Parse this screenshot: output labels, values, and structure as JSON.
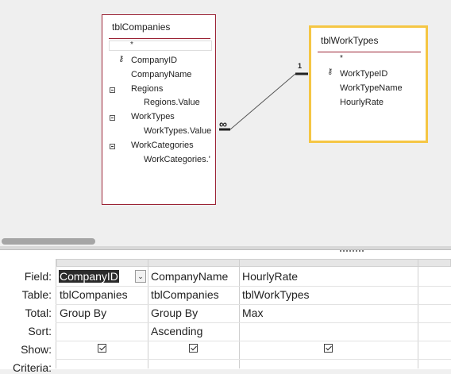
{
  "tables": [
    {
      "name": "tblCompanies",
      "star": "*",
      "fields": [
        {
          "label": "CompanyID",
          "key": true
        },
        {
          "label": "CompanyName"
        },
        {
          "label": "Regions",
          "expander": true
        },
        {
          "label": "Regions.Value",
          "child": true
        },
        {
          "label": "WorkTypes",
          "expander": true
        },
        {
          "label": "WorkTypes.Value",
          "child": true
        },
        {
          "label": "WorkCategories",
          "expander": true
        },
        {
          "label": "WorkCategories.'",
          "child": true
        }
      ]
    },
    {
      "name": "tblWorkTypes",
      "star": "*",
      "fields": [
        {
          "label": "WorkTypeID",
          "key": true
        },
        {
          "label": "WorkTypeName"
        },
        {
          "label": "HourlyRate"
        }
      ]
    }
  ],
  "relationship": {
    "one_label": "1",
    "many_label": "∞"
  },
  "grid": {
    "row_labels": [
      "Field:",
      "Table:",
      "Total:",
      "Sort:",
      "Show:",
      "Criteria:"
    ],
    "columns": [
      {
        "field": "CompanyID",
        "table": "tblCompanies",
        "total": "Group By",
        "sort": "",
        "show": true
      },
      {
        "field": "CompanyName",
        "table": "tblCompanies",
        "total": "Group By",
        "sort": "Ascending",
        "show": true
      },
      {
        "field": "HourlyRate",
        "table": "tblWorkTypes",
        "total": "Max",
        "sort": "",
        "show": true
      }
    ]
  }
}
